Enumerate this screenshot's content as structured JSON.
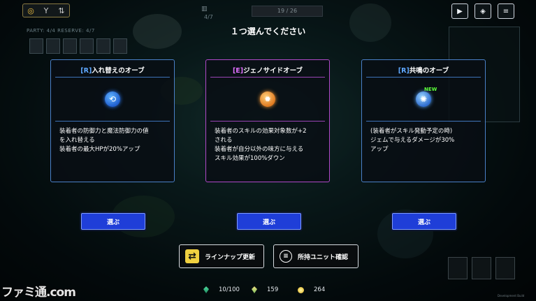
{
  "hud": {
    "party_label": "PARTY: 4/4   RESERVE: 4/7",
    "top_count": "4/7",
    "progress": "19 / 26"
  },
  "prompt": "１つ選んでください",
  "cards": [
    {
      "rank": "[R]",
      "name": "入れ替えのオーブ",
      "icon": "swap-orb-icon",
      "is_new": false,
      "description": "装着者の防御力と魔法防御力の値\nを入れ替える\n装着者の最大HPが20%アップ",
      "button": "選ぶ"
    },
    {
      "rank": "[E]",
      "name": "ジェノサイドオーブ",
      "icon": "genocide-orb-icon",
      "is_new": false,
      "description": "装着者のスキルの効果対象数が+2\nされる\n装着者が自分以外の味方に与える\nスキル効果が100%ダウン",
      "button": "選ぶ"
    },
    {
      "rank": "[R]",
      "name": "共鳴のオーブ",
      "icon": "resonance-orb-icon",
      "is_new": true,
      "new_label": "NEW",
      "description": "(装着者がスキル発動予定の時)\nジェムで与えるダメージが30%\nアップ",
      "button": "選ぶ"
    }
  ],
  "actions": {
    "refresh_label": "ラインナップ更新",
    "units_label": "所持ユニット確認"
  },
  "resources": {
    "units": "10/100",
    "gems": "159",
    "gold": "264"
  },
  "watermark": "ファミ通.com",
  "version": "Development Build",
  "colors": {
    "rare": "#5fa8ff",
    "epic": "#e070ff",
    "select_button": "#1f3ed8"
  }
}
